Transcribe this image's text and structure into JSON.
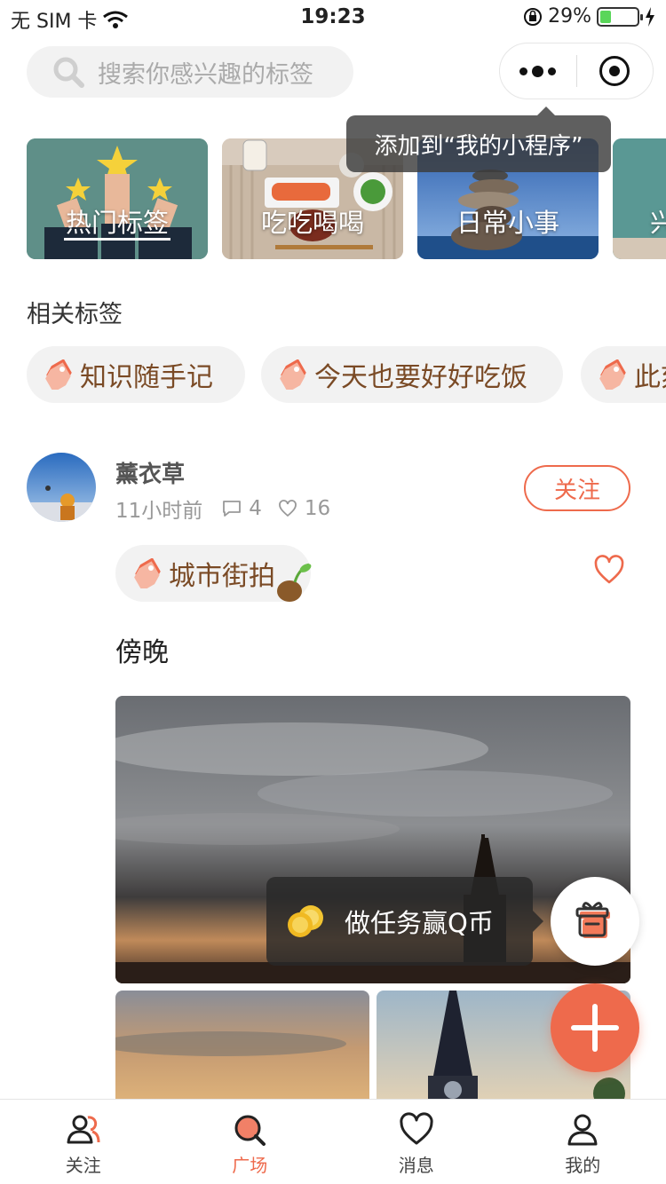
{
  "status_bar": {
    "carrier": "无 SIM 卡",
    "time": "19:23",
    "battery_percent": "29%",
    "battery_level": 0.29
  },
  "search": {
    "placeholder": "搜索你感兴趣的标签"
  },
  "capsule": {
    "more_icon": "more-dots-icon",
    "close_icon": "target-close-icon"
  },
  "tooltip": {
    "text": "添加到“我的小程序”"
  },
  "categories": [
    {
      "label": "热门标签",
      "selected": true
    },
    {
      "label": "吃吃喝喝",
      "selected": false
    },
    {
      "label": "日常小事",
      "selected": false
    },
    {
      "label": "兴",
      "selected": false
    }
  ],
  "related": {
    "title": "相关标签",
    "tags": [
      "知识随手记",
      "今天也要好好吃饭",
      "此刻"
    ]
  },
  "post": {
    "username": "薰衣草",
    "time_ago": "11小时前",
    "comments": "4",
    "likes": "16",
    "follow_label": "关注",
    "tag": "城市街拍",
    "text": "傍晚"
  },
  "task": {
    "label": "做任务赢Q币"
  },
  "tab_bar": {
    "items": [
      {
        "label": "关注",
        "icon": "people-icon",
        "active": false
      },
      {
        "label": "广场",
        "icon": "search-plaza-icon",
        "active": true
      },
      {
        "label": "消息",
        "icon": "heart-icon",
        "active": false
      },
      {
        "label": "我的",
        "icon": "person-icon",
        "active": false
      }
    ]
  },
  "colors": {
    "accent": "#ee6a4c",
    "tag_text": "#7a4a25",
    "chip_bg": "#f2f2f2"
  }
}
